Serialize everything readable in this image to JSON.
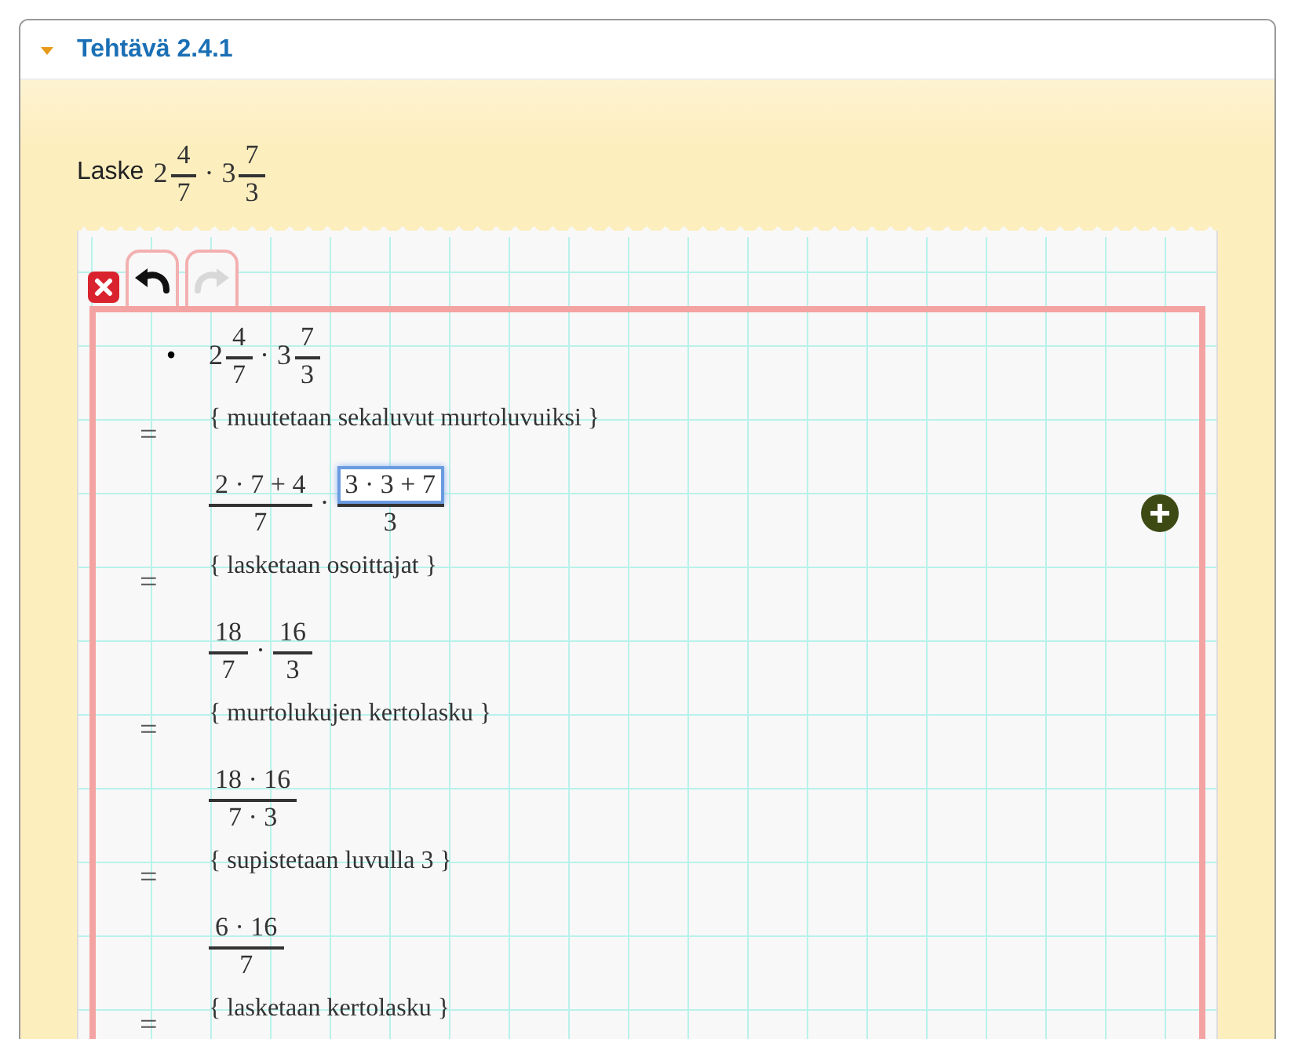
{
  "task": {
    "title": "Tehtävä 2.4.1",
    "expanded": true
  },
  "prompt": {
    "label": "Laske",
    "expr": [
      {
        "kind": "num",
        "text": "2"
      },
      {
        "kind": "frac",
        "num": "4",
        "den": "7",
        "selected": false
      },
      {
        "kind": "op",
        "text": "·"
      },
      {
        "kind": "num",
        "text": "3"
      },
      {
        "kind": "frac",
        "num": "7",
        "den": "3",
        "selected": false
      }
    ]
  },
  "toolbar": [
    {
      "kind": "delete",
      "disabled": false
    },
    {
      "kind": "undo",
      "disabled": false
    },
    {
      "kind": "redo",
      "disabled": true
    }
  ],
  "start": {
    "marker": "•",
    "expr": [
      {
        "kind": "num",
        "text": "2"
      },
      {
        "kind": "frac",
        "num": "4",
        "den": "7",
        "selected": false
      },
      {
        "kind": "op",
        "text": "·"
      },
      {
        "kind": "num",
        "text": "3"
      },
      {
        "kind": "frac",
        "num": "7",
        "den": "3",
        "selected": false
      }
    ]
  },
  "steps": [
    {
      "relation": "=",
      "hint": "{ muutetaan sekaluvut murtoluvuiksi }",
      "expr": [
        {
          "kind": "frac",
          "num": "2 · 7 + 4",
          "den": "7",
          "selected": false
        },
        {
          "kind": "op",
          "text": "·"
        },
        {
          "kind": "frac",
          "num": "3 · 3 + 7",
          "den": "3",
          "selected": true
        }
      ]
    },
    {
      "relation": "=",
      "hint": "{ lasketaan osoittajat }",
      "expr": [
        {
          "kind": "frac",
          "num": "18",
          "den": "7",
          "selected": false
        },
        {
          "kind": "op",
          "text": "·"
        },
        {
          "kind": "frac",
          "num": "16",
          "den": "3",
          "selected": false
        }
      ]
    },
    {
      "relation": "=",
      "hint": "{ murtolukujen kertolasku }",
      "expr": [
        {
          "kind": "frac",
          "num": "18 · 16",
          "den": "7 · 3",
          "selected": false
        }
      ]
    },
    {
      "relation": "=",
      "hint": "{ supistetaan luvulla 3 }",
      "expr": [
        {
          "kind": "frac",
          "num": "6 · 16",
          "den": "7",
          "selected": false
        }
      ]
    },
    {
      "relation": "=",
      "hint": "{ lasketaan kertolasku }"
    }
  ]
}
